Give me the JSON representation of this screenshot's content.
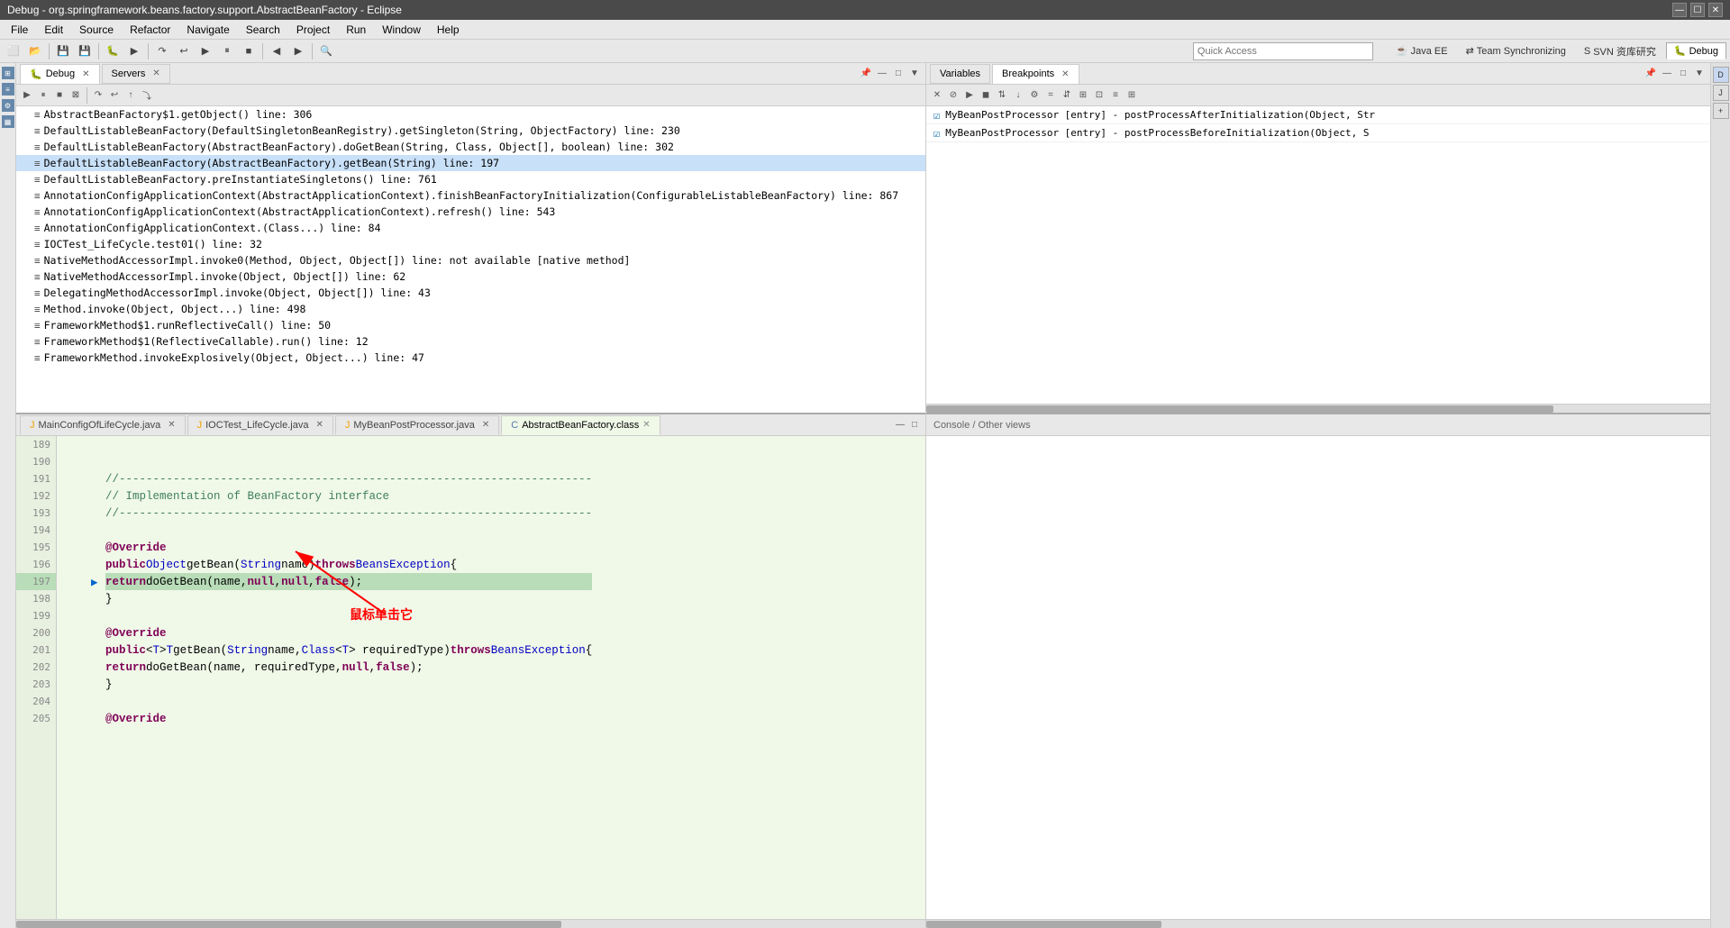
{
  "titlebar": {
    "title": "Debug - org.springframework.beans.factory.support.AbstractBeanFactory - Eclipse",
    "minimize": "—",
    "maximize": "☐",
    "close": "✕"
  },
  "menubar": {
    "items": [
      "File",
      "Edit",
      "Source",
      "Refactor",
      "Navigate",
      "Search",
      "Project",
      "Run",
      "Window",
      "Help"
    ]
  },
  "quickaccess": {
    "label": "Quick Access",
    "placeholder": "Quick Access"
  },
  "debug_panel": {
    "tabs": [
      {
        "label": "Debug",
        "active": true
      },
      {
        "label": "Servers",
        "active": false
      }
    ],
    "stack_frames": [
      {
        "text": "AbstractBeanFactory$1.getObject() line: 306",
        "selected": false
      },
      {
        "text": "DefaultListableBeanFactory(DefaultSingletonBeanRegistry).getSingleton(String, ObjectFactory<?>) line: 230",
        "selected": false
      },
      {
        "text": "DefaultListableBeanFactory(AbstractBeanFactory).doGetBean(String, Class<T>, Object[], boolean) line: 302",
        "selected": false
      },
      {
        "text": "DefaultListableBeanFactory(AbstractBeanFactory).getBean(String) line: 197",
        "selected": true
      },
      {
        "text": "DefaultListableBeanFactory.preInstantiateSingletons() line: 761",
        "selected": false
      },
      {
        "text": "AnnotationConfigApplicationContext(AbstractApplicationContext).finishBeanFactoryInitialization(ConfigurableListableBeanFactory) line: 867",
        "selected": false
      },
      {
        "text": "AnnotationConfigApplicationContext(AbstractApplicationContext).refresh() line: 543",
        "selected": false
      },
      {
        "text": "AnnotationConfigApplicationContext.<init>(Class<?>...) line: 84",
        "selected": false
      },
      {
        "text": "IOCTest_LifeCycle.test01() line: 32",
        "selected": false
      },
      {
        "text": "NativeMethodAccessorImpl.invoke0(Method, Object, Object[]) line: not available [native method]",
        "selected": false
      },
      {
        "text": "NativeMethodAccessorImpl.invoke(Object, Object[]) line: 62",
        "selected": false
      },
      {
        "text": "DelegatingMethodAccessorImpl.invoke(Object, Object[]) line: 43",
        "selected": false
      },
      {
        "text": "Method.invoke(Object, Object...) line: 498",
        "selected": false
      },
      {
        "text": "FrameworkMethod$1.runReflectiveCall() line: 50",
        "selected": false
      },
      {
        "text": "FrameworkMethod$1(ReflectiveCallable).run() line: 12",
        "selected": false
      },
      {
        "text": "FrameworkMethod.invokeExplosively(Object, Object...) line: 47",
        "selected": false
      }
    ]
  },
  "editor_tabs": [
    {
      "label": "MainConfigOfLifeCycle.java",
      "icon": "J",
      "active": false
    },
    {
      "label": "IOCTest_LifeCycle.java",
      "icon": "J",
      "active": false
    },
    {
      "label": "MyBeanPostProcessor.java",
      "icon": "J",
      "active": false
    },
    {
      "label": "AbstractBeanFactory.class",
      "icon": "C",
      "active": true
    }
  ],
  "code": {
    "lines": [
      {
        "num": 189,
        "text": "",
        "style": "normal"
      },
      {
        "num": 190,
        "text": "",
        "style": "normal"
      },
      {
        "num": 191,
        "text": "    //----------------------------------------------------------------------",
        "style": "comment"
      },
      {
        "num": 192,
        "text": "    // Implementation of BeanFactory interface",
        "style": "comment"
      },
      {
        "num": 193,
        "text": "    //----------------------------------------------------------------------",
        "style": "comment"
      },
      {
        "num": 194,
        "text": "",
        "style": "normal"
      },
      {
        "num": 195,
        "text": "    @Override",
        "style": "annotation"
      },
      {
        "num": 196,
        "text": "    public Object getBean(String name) throws BeansException {",
        "style": "code"
      },
      {
        "num": 197,
        "text": "        return doGetBean(name, null, null, false);",
        "style": "exec",
        "arrow": true
      },
      {
        "num": 198,
        "text": "    }",
        "style": "normal"
      },
      {
        "num": 199,
        "text": "",
        "style": "normal"
      },
      {
        "num": 200,
        "text": "    @Override",
        "style": "annotation"
      },
      {
        "num": 201,
        "text": "    public <T> T getBean(String name, Class<T> requiredType) throws BeansException {",
        "style": "code"
      },
      {
        "num": 202,
        "text": "        return doGetBean(name, requiredType, null, false);",
        "style": "normal"
      },
      {
        "num": 203,
        "text": "    }",
        "style": "normal"
      },
      {
        "num": 204,
        "text": "",
        "style": "normal"
      },
      {
        "num": 205,
        "text": "    @Override",
        "style": "annotation"
      }
    ]
  },
  "breakpoints_panel": {
    "tabs": [
      {
        "label": "Variables",
        "active": false
      },
      {
        "label": "Breakpoints",
        "active": true
      }
    ],
    "toolbar_buttons": [
      "×",
      "⊘",
      "▶",
      "◼",
      "↕",
      "↓",
      "⚙",
      "=",
      "↑↓",
      "⊞",
      "⊡",
      "≡",
      "⊞"
    ],
    "entries": [
      {
        "checked": true,
        "text": "MyBeanPostProcessor [entry] - postProcessAfterInitialization(Object, Str"
      },
      {
        "checked": true,
        "text": "MyBeanPostProcessor [entry] - postProcessBeforeInitialization(Object, S"
      }
    ]
  },
  "perspective_tabs": [
    {
      "label": "Java EE",
      "active": false,
      "icon": "☕"
    },
    {
      "label": "Team Synchronizing",
      "active": false,
      "icon": "⇄"
    },
    {
      "label": "SVN 资库研究",
      "active": false,
      "icon": "S"
    },
    {
      "label": "Debug",
      "active": true,
      "icon": "🐛"
    }
  ],
  "annotation": {
    "label": "鼠标单击它"
  }
}
